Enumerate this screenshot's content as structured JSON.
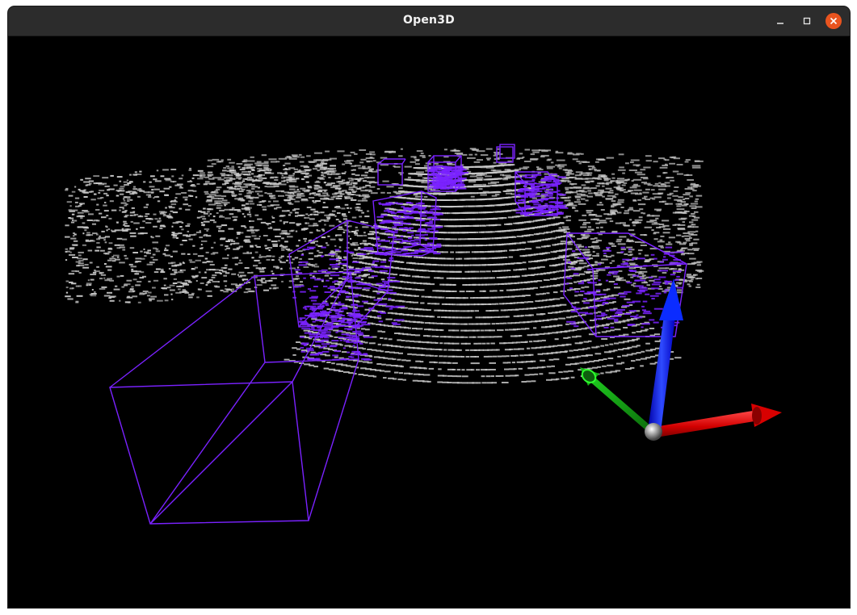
{
  "window": {
    "title": "Open3D",
    "controls": [
      "minimize-icon",
      "maximize-icon",
      "close-icon"
    ],
    "close_color": "#e9541f"
  },
  "scene": {
    "background": "#000000",
    "point_color": "#c8c8c8",
    "box_color": "#7a22ff",
    "axis_colors": {
      "x": "#e01010",
      "y": "#1a9a1a",
      "z": "#1030ff",
      "origin": "#9a9a9a"
    }
  }
}
